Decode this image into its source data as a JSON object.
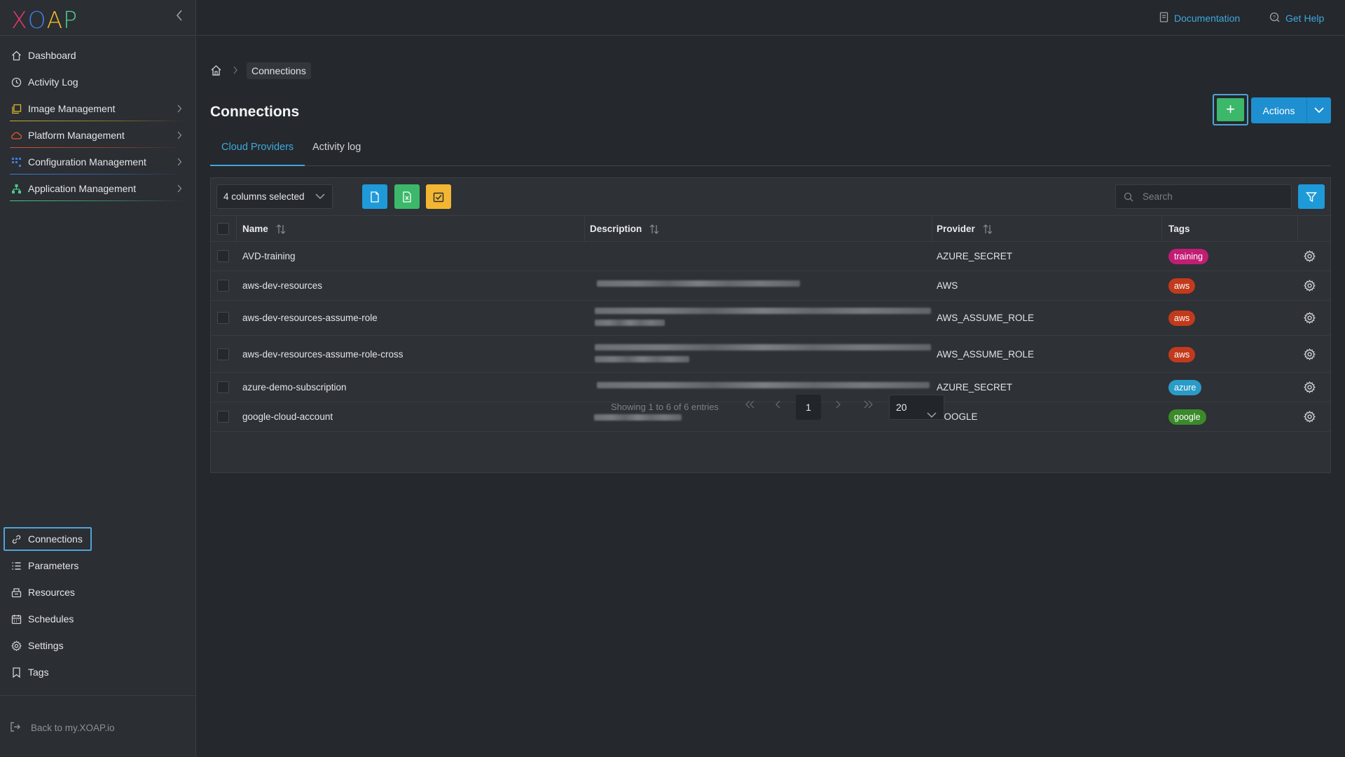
{
  "app": {
    "logo_letters": [
      "X",
      "O",
      "A",
      "P"
    ],
    "logo_colors": [
      "#e23a6c",
      "#3d7de0",
      "#f0b82a",
      "#4cc98a"
    ]
  },
  "topbar": {
    "documentation_label": "Documentation",
    "get_help_label": "Get Help"
  },
  "sidebar": {
    "main_items": [
      {
        "label": "Dashboard",
        "icon": "home-icon",
        "has_children": false,
        "accent": ""
      },
      {
        "label": "Activity Log",
        "icon": "clock-icon",
        "has_children": false,
        "accent": ""
      },
      {
        "label": "Image Management",
        "icon": "image-stack-icon",
        "has_children": true,
        "accent": "#c7b12b"
      },
      {
        "label": "Platform Management",
        "icon": "cloud-icon",
        "has_children": true,
        "accent": "#d4552c"
      },
      {
        "label": "Configuration Management",
        "icon": "config-grid-icon",
        "has_children": true,
        "accent": "#3d7de0"
      },
      {
        "label": "Application Management",
        "icon": "app-tree-icon",
        "has_children": true,
        "accent": "#4cc98a"
      }
    ],
    "bottom_items": [
      {
        "label": "Connections",
        "icon": "link-icon",
        "active": true
      },
      {
        "label": "Parameters",
        "icon": "list-icon",
        "active": false
      },
      {
        "label": "Resources",
        "icon": "resources-icon",
        "active": false
      },
      {
        "label": "Schedules",
        "icon": "calendar-icon",
        "active": false
      },
      {
        "label": "Settings",
        "icon": "gear-icon",
        "active": false
      },
      {
        "label": "Tags",
        "icon": "bookmark-icon",
        "active": false
      }
    ],
    "back_label": "Back to my.XOAP.io"
  },
  "breadcrumb": {
    "current": "Connections"
  },
  "page": {
    "title": "Connections",
    "actions_label": "Actions"
  },
  "tabs": [
    {
      "label": "Cloud Providers",
      "active": true
    },
    {
      "label": "Activity log",
      "active": false
    }
  ],
  "toolbar": {
    "columns_selected": "4 columns selected",
    "search_placeholder": "Search"
  },
  "table": {
    "headers": {
      "name": "Name",
      "description": "Description",
      "provider": "Provider",
      "tags": "Tags"
    },
    "rows": [
      {
        "name": "AVD-training",
        "provider": "AZURE_SECRET",
        "tag": "training",
        "tag_color": "#c21d74"
      },
      {
        "name": "aws-dev-resources",
        "provider": "AWS",
        "tag": "aws",
        "tag_color": "#c23a1c"
      },
      {
        "name": "aws-dev-resources-assume-role",
        "provider": "AWS_ASSUME_ROLE",
        "tag": "aws",
        "tag_color": "#c23a1c"
      },
      {
        "name": "aws-dev-resources-assume-role-cross",
        "provider": "AWS_ASSUME_ROLE",
        "tag": "aws",
        "tag_color": "#c23a1c"
      },
      {
        "name": "azure-demo-subscription",
        "provider": "AZURE_SECRET",
        "tag": "azure",
        "tag_color": "#2a9bc7"
      },
      {
        "name": "google-cloud-account",
        "provider": "GOOGLE",
        "tag": "google",
        "tag_color": "#3a8a2a"
      }
    ]
  },
  "pagination": {
    "info": "Showing 1 to 6 of 6 entries",
    "current_page": "1",
    "page_size": "20"
  }
}
